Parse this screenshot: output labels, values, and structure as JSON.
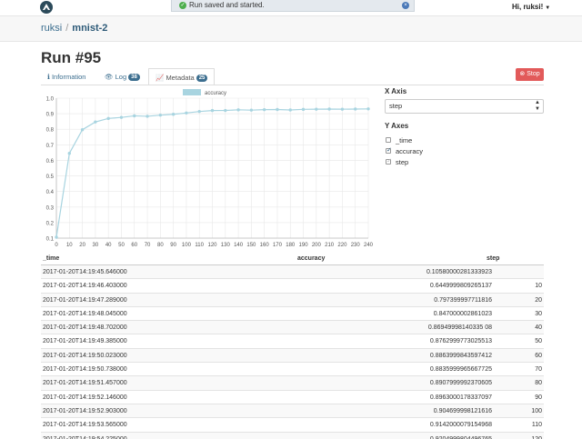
{
  "header": {
    "toast_text": "Run saved and started.",
    "user_label": "Hi, ruksi!"
  },
  "breadcrumb": {
    "owner": "ruksi",
    "separator": "/",
    "project": "mnist-2"
  },
  "run": {
    "title": "Run #95",
    "stop_label": "Stop"
  },
  "tabs": [
    {
      "label": "Information",
      "badge": ""
    },
    {
      "label": "Log",
      "badge": "38"
    },
    {
      "label": "Metadata",
      "badge": "25"
    }
  ],
  "controls": {
    "x_axis_label": "X Axis",
    "x_axis_value": "step",
    "y_axes_label": "Y Axes",
    "y_options": [
      {
        "label": "_time",
        "checked": false
      },
      {
        "label": "accuracy",
        "checked": true
      },
      {
        "label": "step",
        "checked": true
      }
    ]
  },
  "chart_data": {
    "type": "line",
    "legend": [
      "accuracy"
    ],
    "x": [
      0,
      10,
      20,
      30,
      40,
      50,
      60,
      70,
      80,
      90,
      100,
      110,
      120,
      130,
      140,
      150,
      160,
      170,
      180,
      190,
      200,
      210,
      220,
      230,
      240
    ],
    "series": [
      {
        "name": "accuracy",
        "color": "#a8d4e0",
        "values": [
          0.1058,
          0.645,
          0.797,
          0.847,
          0.8695,
          0.8763,
          0.8864,
          0.8836,
          0.8908,
          0.8963,
          0.9047,
          0.9142,
          0.9205,
          0.921,
          0.925,
          0.923,
          0.926,
          0.927,
          0.924,
          0.928,
          0.929,
          0.93,
          0.929,
          0.93,
          0.931
        ]
      }
    ],
    "xlim": [
      0,
      240
    ],
    "ylim": [
      0.1,
      1.0
    ],
    "x_ticks": [
      0,
      10,
      20,
      30,
      40,
      50,
      60,
      70,
      80,
      90,
      100,
      110,
      120,
      130,
      140,
      150,
      160,
      170,
      180,
      190,
      200,
      210,
      220,
      230,
      240
    ],
    "y_ticks": [
      0.1,
      0.2,
      0.3,
      0.4,
      0.5,
      0.6,
      0.7,
      0.8,
      0.9,
      1.0
    ],
    "y_tick_labels": [
      "0.1",
      "0.2",
      "0.3",
      "0.4",
      "0.5",
      "0.6",
      "0.7",
      "0.8",
      "0.9",
      "1.0"
    ],
    "grid": true
  },
  "table": {
    "headers": [
      "_time",
      "accuracy",
      "step"
    ],
    "rows": [
      [
        "2017-01-20T14:19:45.646000",
        "0.10580000281333923",
        ""
      ],
      [
        "2017-01-20T14:19:46.403000",
        "0.6449999809265137",
        "10"
      ],
      [
        "2017-01-20T14:19:47.289000",
        "0.797399997711816",
        "20"
      ],
      [
        "2017-01-20T14:19:48.045000",
        "0.847000002861023",
        "30"
      ],
      [
        "2017-01-20T14:19:48.702000",
        "0.86949998140335 08",
        "40"
      ],
      [
        "2017-01-20T14:19:49.385000",
        "0.8762999773025513",
        "50"
      ],
      [
        "2017-01-20T14:19:50.023000",
        "0.8863999843597412",
        "60"
      ],
      [
        "2017-01-20T14:19:50.738000",
        "0.8835999965667725",
        "70"
      ],
      [
        "2017-01-20T14:19:51.457000",
        "0.8907999992370605",
        "80"
      ],
      [
        "2017-01-20T14:19:52.146000",
        "0.8963000178337097",
        "90"
      ],
      [
        "2017-01-20T14:19:52.903000",
        "0.904699998121616",
        "100"
      ],
      [
        "2017-01-20T14:19:53.565000",
        "0.9142000079154968",
        "110"
      ],
      [
        "2017-01-20T14:19:54.225000",
        "0.9204999804496765",
        "120"
      ]
    ]
  }
}
